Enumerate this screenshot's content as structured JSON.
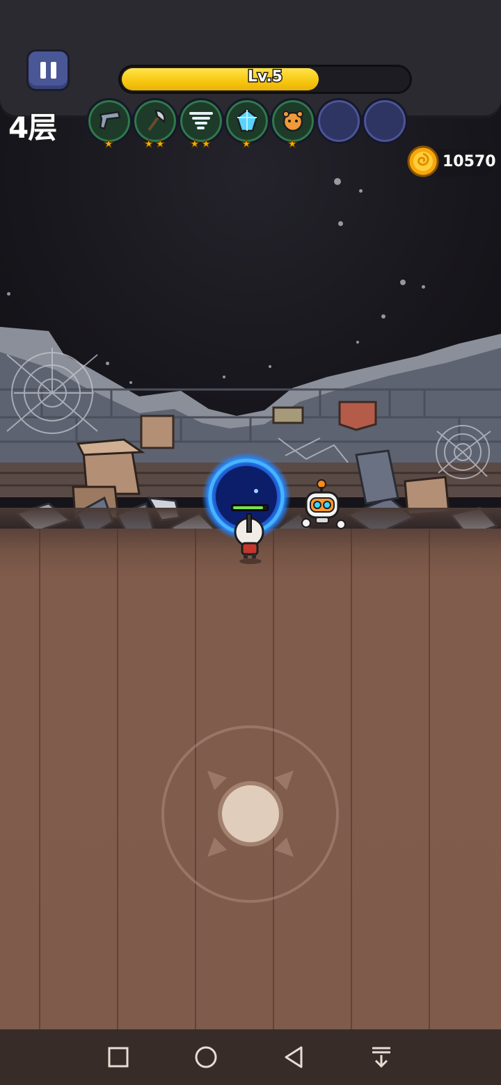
{
  "hud": {
    "floor_label": "4层",
    "level_label": "Lv.5",
    "xp_progress": 0.68,
    "coins": "10570"
  },
  "skills": [
    {
      "icon": "pistol-icon",
      "stars": "★",
      "filled": true
    },
    {
      "icon": "axe-icon",
      "stars": "★★",
      "filled": true
    },
    {
      "icon": "tornado-icon",
      "stars": "★★",
      "filled": true
    },
    {
      "icon": "ice-crystal-icon",
      "stars": "★",
      "filled": true
    },
    {
      "icon": "hamster-pet-icon",
      "stars": "★",
      "filled": true
    },
    {
      "icon": "empty-slot",
      "stars": "",
      "filled": false
    },
    {
      "icon": "empty-slot",
      "stars": "",
      "filled": false
    }
  ],
  "player": {
    "health_fraction": 0.9
  },
  "colors": {
    "xp_fill": "#f7c70e",
    "pause_button": "#4a5796",
    "portal": "#1f7bff",
    "floor": "#7e5a4b",
    "navbar": "#372c28"
  },
  "navbar": {
    "icons": [
      "recent-apps-icon",
      "home-icon",
      "back-icon",
      "notification-pulldown-icon"
    ]
  }
}
